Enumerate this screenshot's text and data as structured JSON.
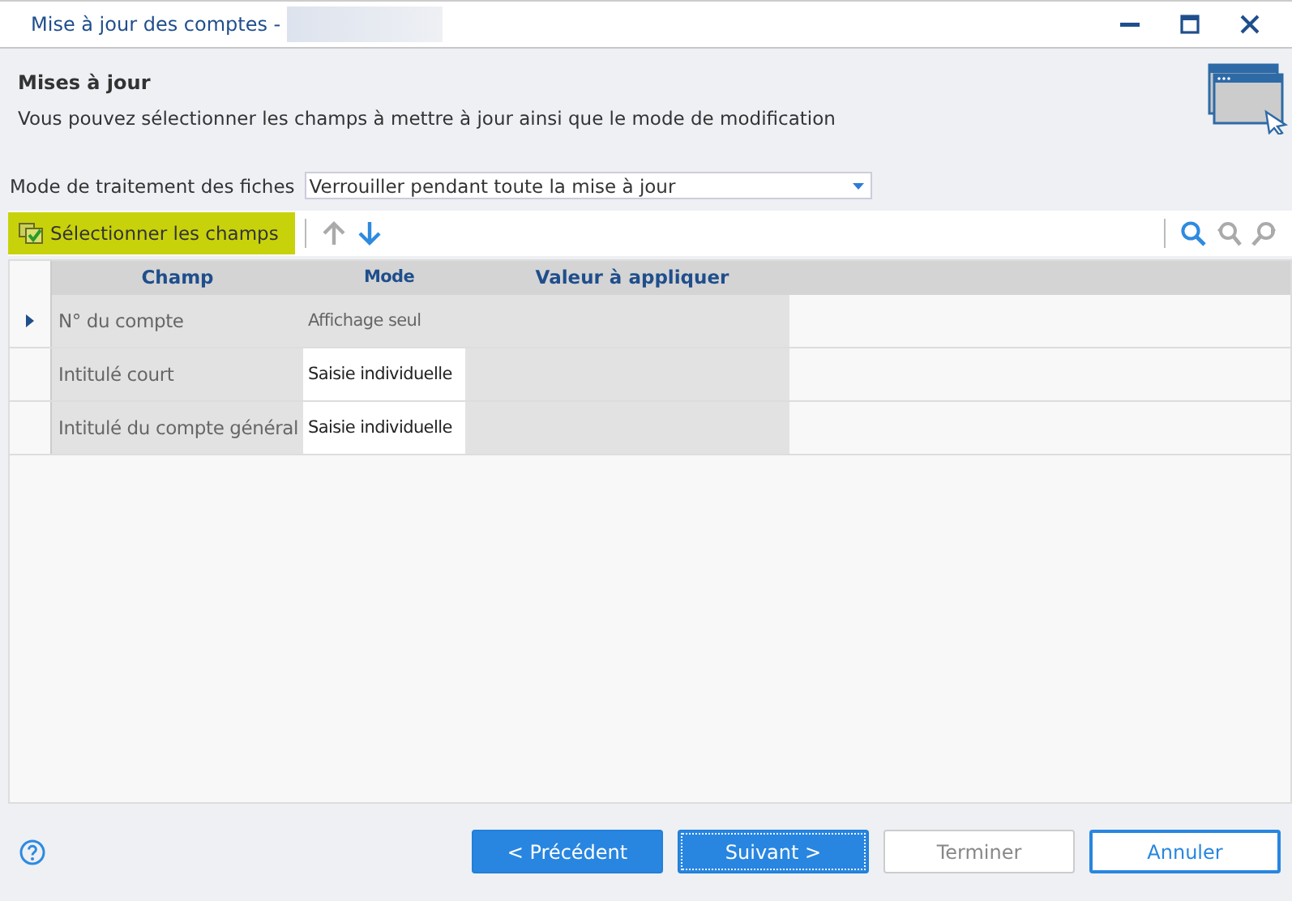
{
  "window": {
    "title": "Mise à jour des comptes -"
  },
  "header": {
    "title": "Mises à jour",
    "description": "Vous pouvez sélectionner les champs à mettre à jour ainsi que le mode de modification"
  },
  "processing_mode": {
    "label": "Mode de traitement des fiches",
    "value": "Verrouiller pendant toute la mise à jour"
  },
  "toolbar": {
    "select_fields": "Sélectionner les champs",
    "move_up_disabled": true,
    "move_down_disabled": false
  },
  "table": {
    "columns": [
      "Champ",
      "Mode",
      "Valeur à appliquer"
    ],
    "rows": [
      {
        "champ": "N° du compte",
        "mode": "Affichage seul",
        "value": "",
        "selected": true,
        "editable": false
      },
      {
        "champ": "Intitulé court",
        "mode": "Saisie individuelle",
        "value": "",
        "selected": false,
        "editable": true
      },
      {
        "champ": "Intitulé du compte général",
        "mode": "Saisie individuelle",
        "value": "",
        "selected": false,
        "editable": true
      }
    ]
  },
  "buttons": [
    {
      "label": "< Précédent",
      "kind": "primary",
      "disabled": false,
      "focused": false
    },
    {
      "label": "Suivant >",
      "kind": "primary",
      "disabled": false,
      "focused": true
    },
    {
      "label": "Terminer",
      "kind": "default",
      "disabled": true,
      "focused": false
    },
    {
      "label": "Annuler",
      "kind": "outline",
      "disabled": false,
      "focused": false
    }
  ]
}
